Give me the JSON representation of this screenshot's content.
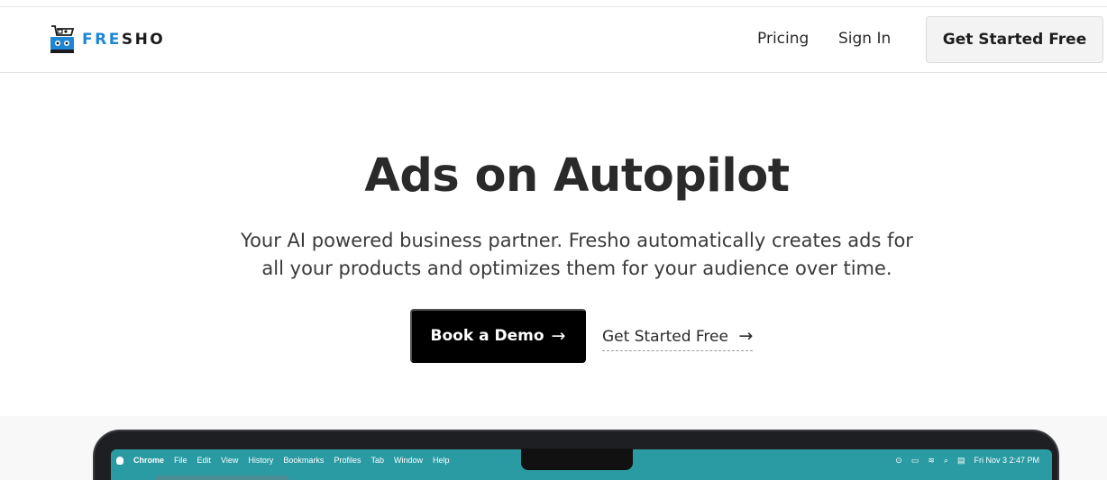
{
  "brand": {
    "name_a": "FRE",
    "name_b": "SHO"
  },
  "nav": {
    "pricing": "Pricing",
    "signin": "Sign In",
    "cta": "Get Started Free"
  },
  "hero": {
    "title": "Ads on Autopilot",
    "subtitle_line1": "Your AI powered business partner. Fresho automatically creates ads for",
    "subtitle_line2": "all your products and optimizes them for your audience over time.",
    "primary_cta": "Book a Demo",
    "secondary_cta": "Get Started Free",
    "arrow": "→"
  },
  "mockup_menubar": {
    "app": "Chrome",
    "items": [
      "File",
      "Edit",
      "View",
      "History",
      "Bookmarks",
      "Profiles",
      "Tab",
      "Window",
      "Help"
    ],
    "clock": "Fri Nov 3  2:47 PM"
  },
  "colors": {
    "brand_blue": "#1f86d6",
    "primary_button": "#000000",
    "mock_screen": "#2a9aa3"
  }
}
